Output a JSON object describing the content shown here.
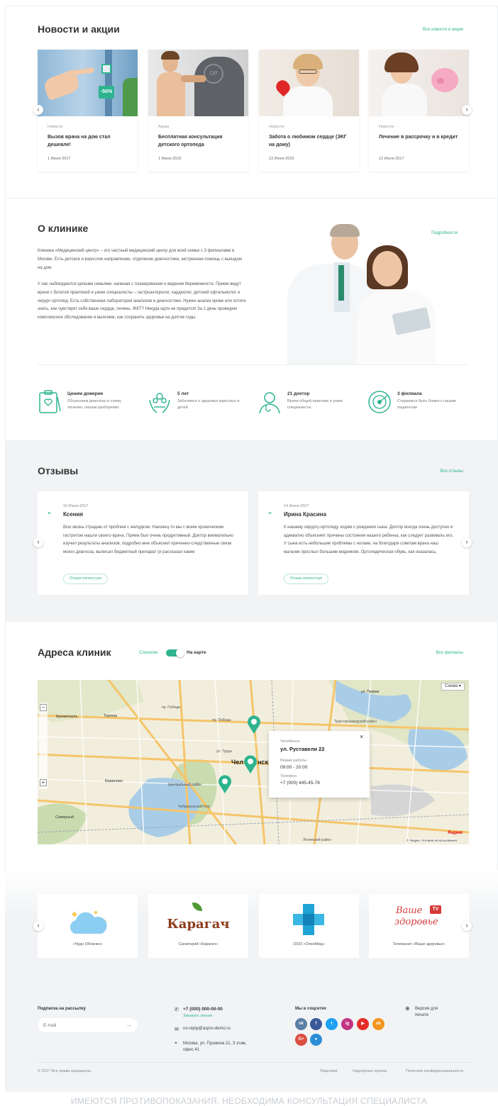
{
  "news": {
    "title": "Новости и акции",
    "all_link": "Все новости и акции",
    "items": [
      {
        "category": "Новости",
        "title": "Вызов врача на дом стал дешевле!",
        "date": "1 Июня 2017",
        "badge": "-50%"
      },
      {
        "category": "Акции",
        "title": "Бесплатная консультация детского ортопеда",
        "date": "1 Июня 2016"
      },
      {
        "category": "Новости",
        "title": "Забота о любимом сердце (ЭКГ на дому)",
        "date": "13 Июня 2015"
      },
      {
        "category": "Новости",
        "title": "Лечение в рассрочку и в кредит",
        "date": "12 Июня 2017"
      }
    ]
  },
  "about": {
    "title": "О клинике",
    "more_link": "Подробности",
    "p1": "Клиника «Медицинский центр» – это частный медицинский центр для всей семьи с 3 филиалами в Москве. Есть детское и взрослое направление, отделение диагностики, экстренная помощь с выездом на дом.",
    "p2": "У нас наблюдаются целыми семьями, начиная с планирования и ведения беременности. Прием ведут врачи с богатой практикой и узкие специалисты – гастроэнтеролог, кардиолог, детский офтальмолог и хирург-ортопед. Есть собственная лаборатория анализов и диагностики. Нужен анализ крови или хотите знать, как чувствует себя ваше сердце, печень, ЖКТ? Никуда идти не придется! За 1 день проведем комплексное обследование и выясним, как сохранить здоровье на долгие годы.",
    "features": [
      {
        "title": "Ценим доверие",
        "desc": "Объясняем диагнозы и схему лечения, пишем разборчиво"
      },
      {
        "title": "5 лет",
        "desc": "Заботимся о здоровье взрослых и детей"
      },
      {
        "title": "21 доктор",
        "desc": "Врачи общей практики и узкие специалисты"
      },
      {
        "title": "3 филиала",
        "desc": "Стараемся быть ближе к нашим пациентам"
      }
    ]
  },
  "reviews": {
    "title": "Отзывы",
    "all_link": "Все отзывы",
    "items": [
      {
        "date": "10 Июня 2017",
        "name": "Ксения",
        "text": "Всю жизнь страдаю от проблем с желудком. Наконец-то мы с моим хроническим гастритом нашли своего врача. Прием был очень продуктивный. Доктор внимательно изучил результаты анализов, подробно мне объяснил причинно-следственные связи моего диагноза, выписал бюджетный препарат (и рассказал какие",
        "button": "Отзыв полностью"
      },
      {
        "date": "14 Июня 2017",
        "name": "Ирина Красина",
        "text": "К нашему хирургу-ортопеду ходим с рождения сына. Доктор всегда очень доступно и адекватно объясняет причины состояния нашего ребенка, как следует развивать его. У сына есть небольшие проблемы с ногами, на благодаря советам врача наш мальчик прослыл большим модником. Ортопедическая обувь, как оказалась,",
        "button": "Отзыв полностью"
      }
    ]
  },
  "addresses": {
    "title": "Адреса клиник",
    "toggle_list": "Списком",
    "toggle_map": "На карте",
    "all_link": "Все филиалы",
    "map": {
      "scheme": "Схема ▾",
      "popup": {
        "city": "Челябинск",
        "street": "ул. Руставели 22",
        "hours_label": "Режим работы",
        "hours": "09:00 - 20:00",
        "phone_label": "Телефон",
        "phone": "+7 (000) 445-45-78",
        "close": "×"
      },
      "labels": [
        "Кременкуль",
        "Терема",
        "Челябинск",
        "Вавилово",
        "Северный",
        "Центральный район",
        "Чебаркульский бор",
        "ул. Первая",
        "Тракторозаводский район",
        "Ленинский район",
        "пр. Победы",
        "пр. Победы",
        "ул. Труда",
        "Яндекс",
        "© Яндекс Условия использования"
      ],
      "city_partial": "Чел",
      "city_partial2": "нск"
    }
  },
  "partners": [
    {
      "name": "«Чудо Облачко»"
    },
    {
      "name": "Санаторий «Карагач»",
      "logo": "Карагач"
    },
    {
      "name": "ООО «ОпенМед»"
    },
    {
      "name": "Телеканал «Ваше здоровье»",
      "logo1": "Ваше",
      "logo2": "здоровье",
      "tv": "TV"
    }
  ],
  "footer": {
    "subscribe_title": "Подписка на рассылку",
    "email_placeholder": "E-mail",
    "phone": "+7 (000) 000-00-00",
    "callback": "Заказать звонок",
    "email": "no-reply@aspro-demo.ru",
    "address": "Москва, ул. Пушкина 21, 3 этаж, офис 41",
    "social_title": "Мы в соцсетях",
    "print": "Версия для печати",
    "copyright": "© 2017 Все права защищены.",
    "links": [
      "Лицензии",
      "Надзорные органы",
      "Политика конфиденциальности"
    ],
    "socials": [
      {
        "name": "vk",
        "label": "vk",
        "color": "#5b7fa6"
      },
      {
        "name": "facebook",
        "label": "f",
        "color": "#3b5998"
      },
      {
        "name": "twitter",
        "label": "t",
        "color": "#1da1f2"
      },
      {
        "name": "instagram",
        "label": "ig",
        "color": "#c13584"
      },
      {
        "name": "youtube",
        "label": "▶",
        "color": "#e52d27"
      },
      {
        "name": "odnoklassniki",
        "label": "ok",
        "color": "#f2941f"
      },
      {
        "name": "google-plus",
        "label": "G+",
        "color": "#dc4e41"
      },
      {
        "name": "other",
        "label": "●",
        "color": "#2b8fd6"
      }
    ]
  },
  "disclaimer": "ИМЕЮТСЯ ПРОТИВОПОКАЗАНИЯ. НЕОБХОДИМА КОНСУЛЬТАЦИЯ СПЕЦИАЛИСТА",
  "colors": {
    "accent": "#2db48f",
    "gray_bg": "#f1f3f5"
  }
}
